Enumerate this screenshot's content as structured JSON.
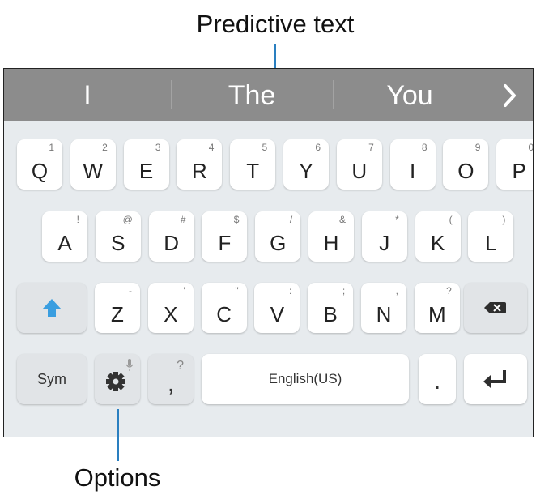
{
  "callouts": {
    "predictive_text": "Predictive text",
    "options": "Options"
  },
  "prediction_bar": {
    "suggestions": [
      "I",
      "The",
      "You"
    ],
    "more_icon": "chevron-right-icon"
  },
  "keyboard": {
    "row1": [
      {
        "label": "Q",
        "sub": "1"
      },
      {
        "label": "W",
        "sub": "2"
      },
      {
        "label": "E",
        "sub": "3"
      },
      {
        "label": "R",
        "sub": "4"
      },
      {
        "label": "T",
        "sub": "5"
      },
      {
        "label": "Y",
        "sub": "6"
      },
      {
        "label": "U",
        "sub": "7"
      },
      {
        "label": "I",
        "sub": "8"
      },
      {
        "label": "O",
        "sub": "9"
      },
      {
        "label": "P",
        "sub": "0"
      }
    ],
    "row2": [
      {
        "label": "A",
        "sub": "!"
      },
      {
        "label": "S",
        "sub": "@"
      },
      {
        "label": "D",
        "sub": "#"
      },
      {
        "label": "F",
        "sub": "$"
      },
      {
        "label": "G",
        "sub": "/"
      },
      {
        "label": "H",
        "sub": "&"
      },
      {
        "label": "J",
        "sub": "*"
      },
      {
        "label": "K",
        "sub": "("
      },
      {
        "label": "L",
        "sub": ")"
      }
    ],
    "row3": [
      {
        "label": "Z",
        "sub": "-"
      },
      {
        "label": "X",
        "sub": "'"
      },
      {
        "label": "C",
        "sub": "\""
      },
      {
        "label": "V",
        "sub": ":"
      },
      {
        "label": "B",
        "sub": ";"
      },
      {
        "label": "N",
        "sub": ","
      },
      {
        "label": "M",
        "sub": "?"
      }
    ],
    "shift_icon": "shift-arrow-icon",
    "backspace_icon": "backspace-icon",
    "sym_label": "Sym",
    "settings_icon": "gear-icon",
    "mic_icon": "mic-icon",
    "comma_label": ",",
    "comma_sub": "?",
    "space_label": "English(US)",
    "period_label": ".",
    "enter_icon": "enter-arrow-icon",
    "accent_color": "#3a9ee0"
  }
}
